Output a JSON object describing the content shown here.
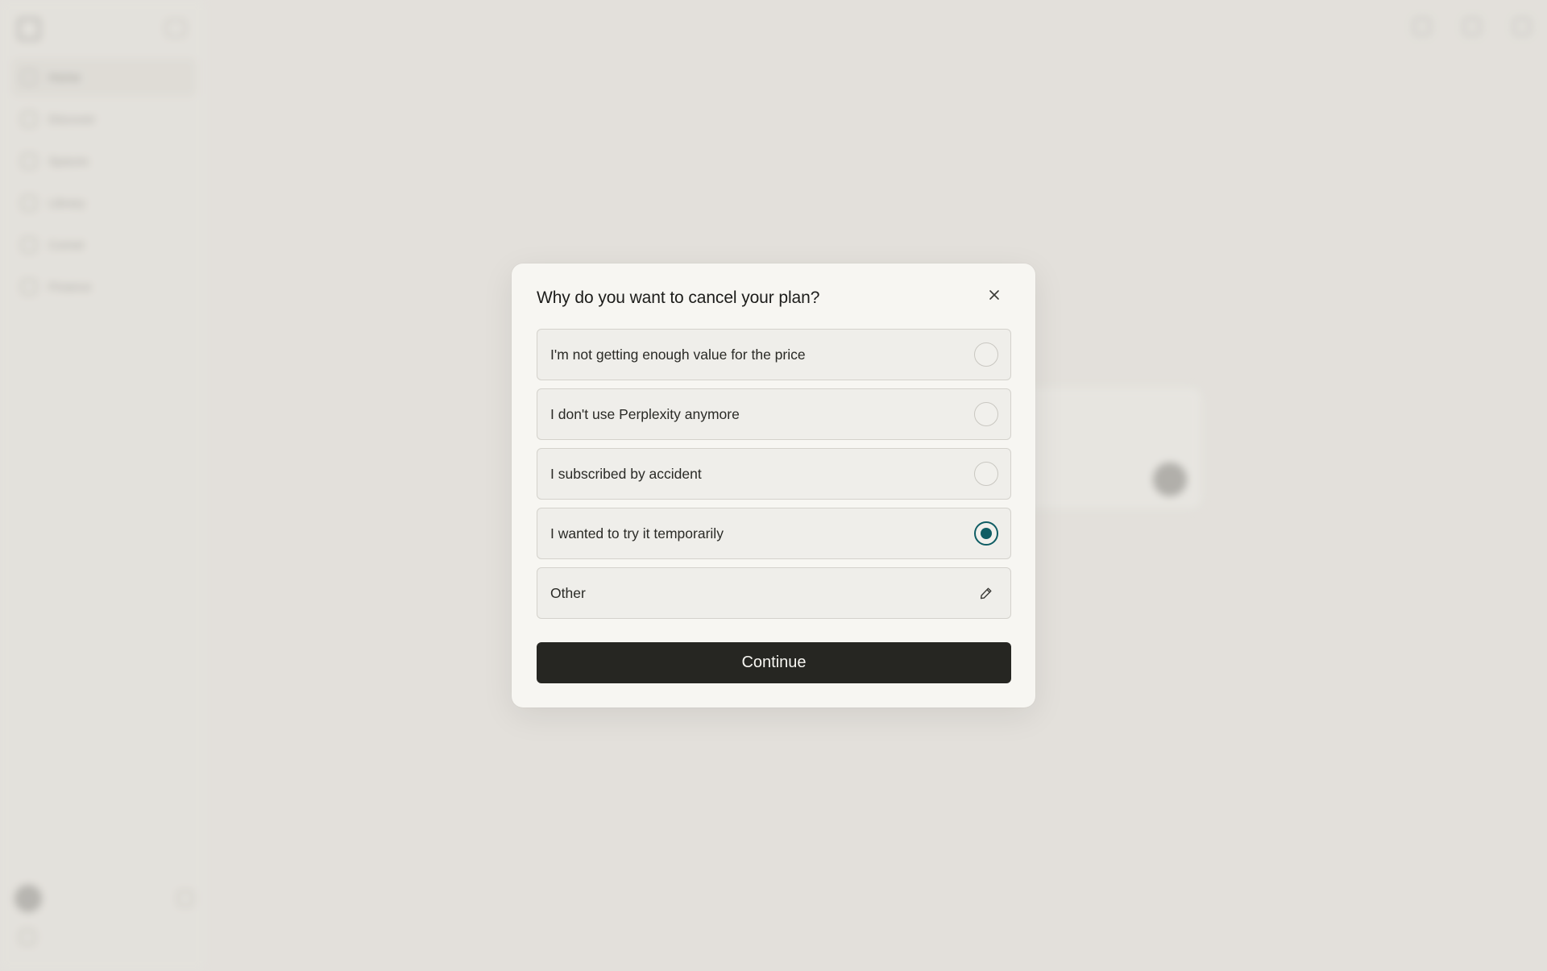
{
  "background": {
    "sidebar": {
      "items": [
        {
          "label": "Home",
          "active": true
        },
        {
          "label": "Discover"
        },
        {
          "label": "Spaces"
        },
        {
          "label": "Library"
        },
        {
          "label": "Comet"
        },
        {
          "label": "Finance"
        }
      ],
      "user_name": "",
      "download_label": ""
    },
    "top_tabs": [],
    "hero_title": "",
    "ask_model_label": ""
  },
  "dialog": {
    "title": "Why do you want to cancel your plan?",
    "options": [
      {
        "label": "I'm not getting enough value for the price",
        "selected": false
      },
      {
        "label": "I don't use Perplexity anymore",
        "selected": false
      },
      {
        "label": "I subscribed by accident",
        "selected": false
      },
      {
        "label": "I wanted to try it temporarily",
        "selected": true
      },
      {
        "label": "Other",
        "selected": false,
        "icon": "pencil-icon"
      }
    ],
    "continue_label": "Continue",
    "close_icon": "close-icon"
  },
  "colors": {
    "accent": "#0f5d64",
    "button_bg": "#262622",
    "dialog_bg": "#f7f6f2",
    "page_bg": "#e3e1dc"
  }
}
